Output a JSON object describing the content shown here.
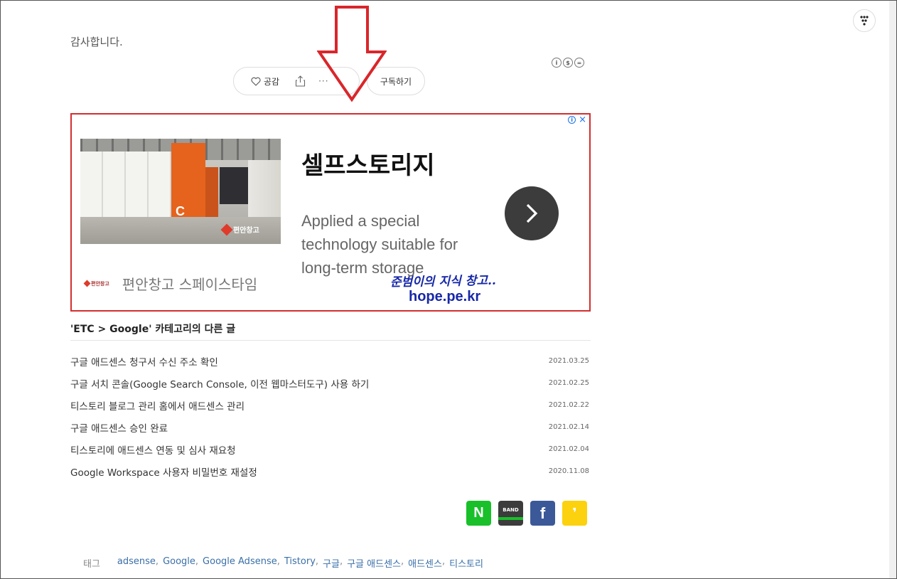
{
  "greeting": "감사합니다.",
  "reactions": {
    "like_label": "공감",
    "more_label": "···",
    "subscribe_label": "구독하기"
  },
  "license": [
    "i",
    "$",
    "="
  ],
  "ad": {
    "title": "셀프스토리지",
    "description": "Applied a special technology suitable for long-term storage",
    "brand_logo_text": "편안창고",
    "brand_name": "편안창고 스페이스타임",
    "photo_letter": "C",
    "photo_watermark": "편안창고"
  },
  "watermark": {
    "handwritten": "준범이의 지식 창고..",
    "site": "hope.pe.kr"
  },
  "related": {
    "title": "'ETC > Google' 카테고리의 다른 글",
    "items": [
      {
        "title": "구글 애드센스 청구서 수신 주소 확인",
        "date": "2021.03.25"
      },
      {
        "title": "구글 서치 콘솔(Google Search Console, 이전 웹마스터도구) 사용 하기",
        "date": "2021.02.25"
      },
      {
        "title": "티스토리 블로그 관리 홈에서 애드센스 관리",
        "date": "2021.02.22"
      },
      {
        "title": "구글 애드센스 승인 완료",
        "date": "2021.02.14"
      },
      {
        "title": "티스토리에 애드센스 연동 및 심사 재요청",
        "date": "2021.02.04"
      },
      {
        "title": "Google Workspace 사용자 비밀번호 재설정",
        "date": "2020.11.08"
      }
    ]
  },
  "share": {
    "naver": "N",
    "band": "BAND",
    "facebook": "f",
    "kakao": "❜"
  },
  "tags": {
    "label": "태그",
    "items": [
      "adsense",
      "Google",
      "Google Adsense",
      "Tistory",
      "구글",
      "구글 애드센스",
      "애드센스",
      "티스토리"
    ],
    "separator": ","
  },
  "colors": {
    "ad_border": "#d32f2f",
    "tag_link": "#3a6fa8",
    "naver_green": "#19c02a",
    "facebook_blue": "#3b5998",
    "kakao_yellow": "#fcd10d"
  }
}
